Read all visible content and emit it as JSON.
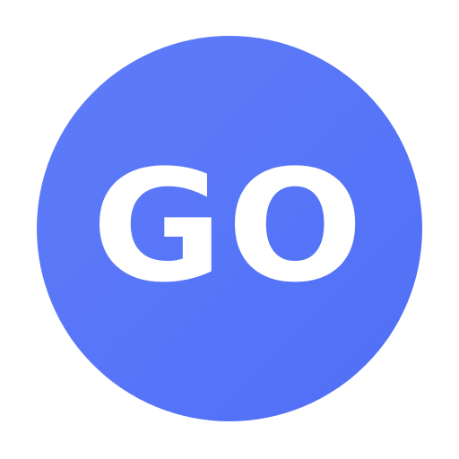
{
  "icon": {
    "label": "GO",
    "shape": "circle",
    "background_color": "#5A77F8",
    "text_color": "#FFFFFF"
  }
}
